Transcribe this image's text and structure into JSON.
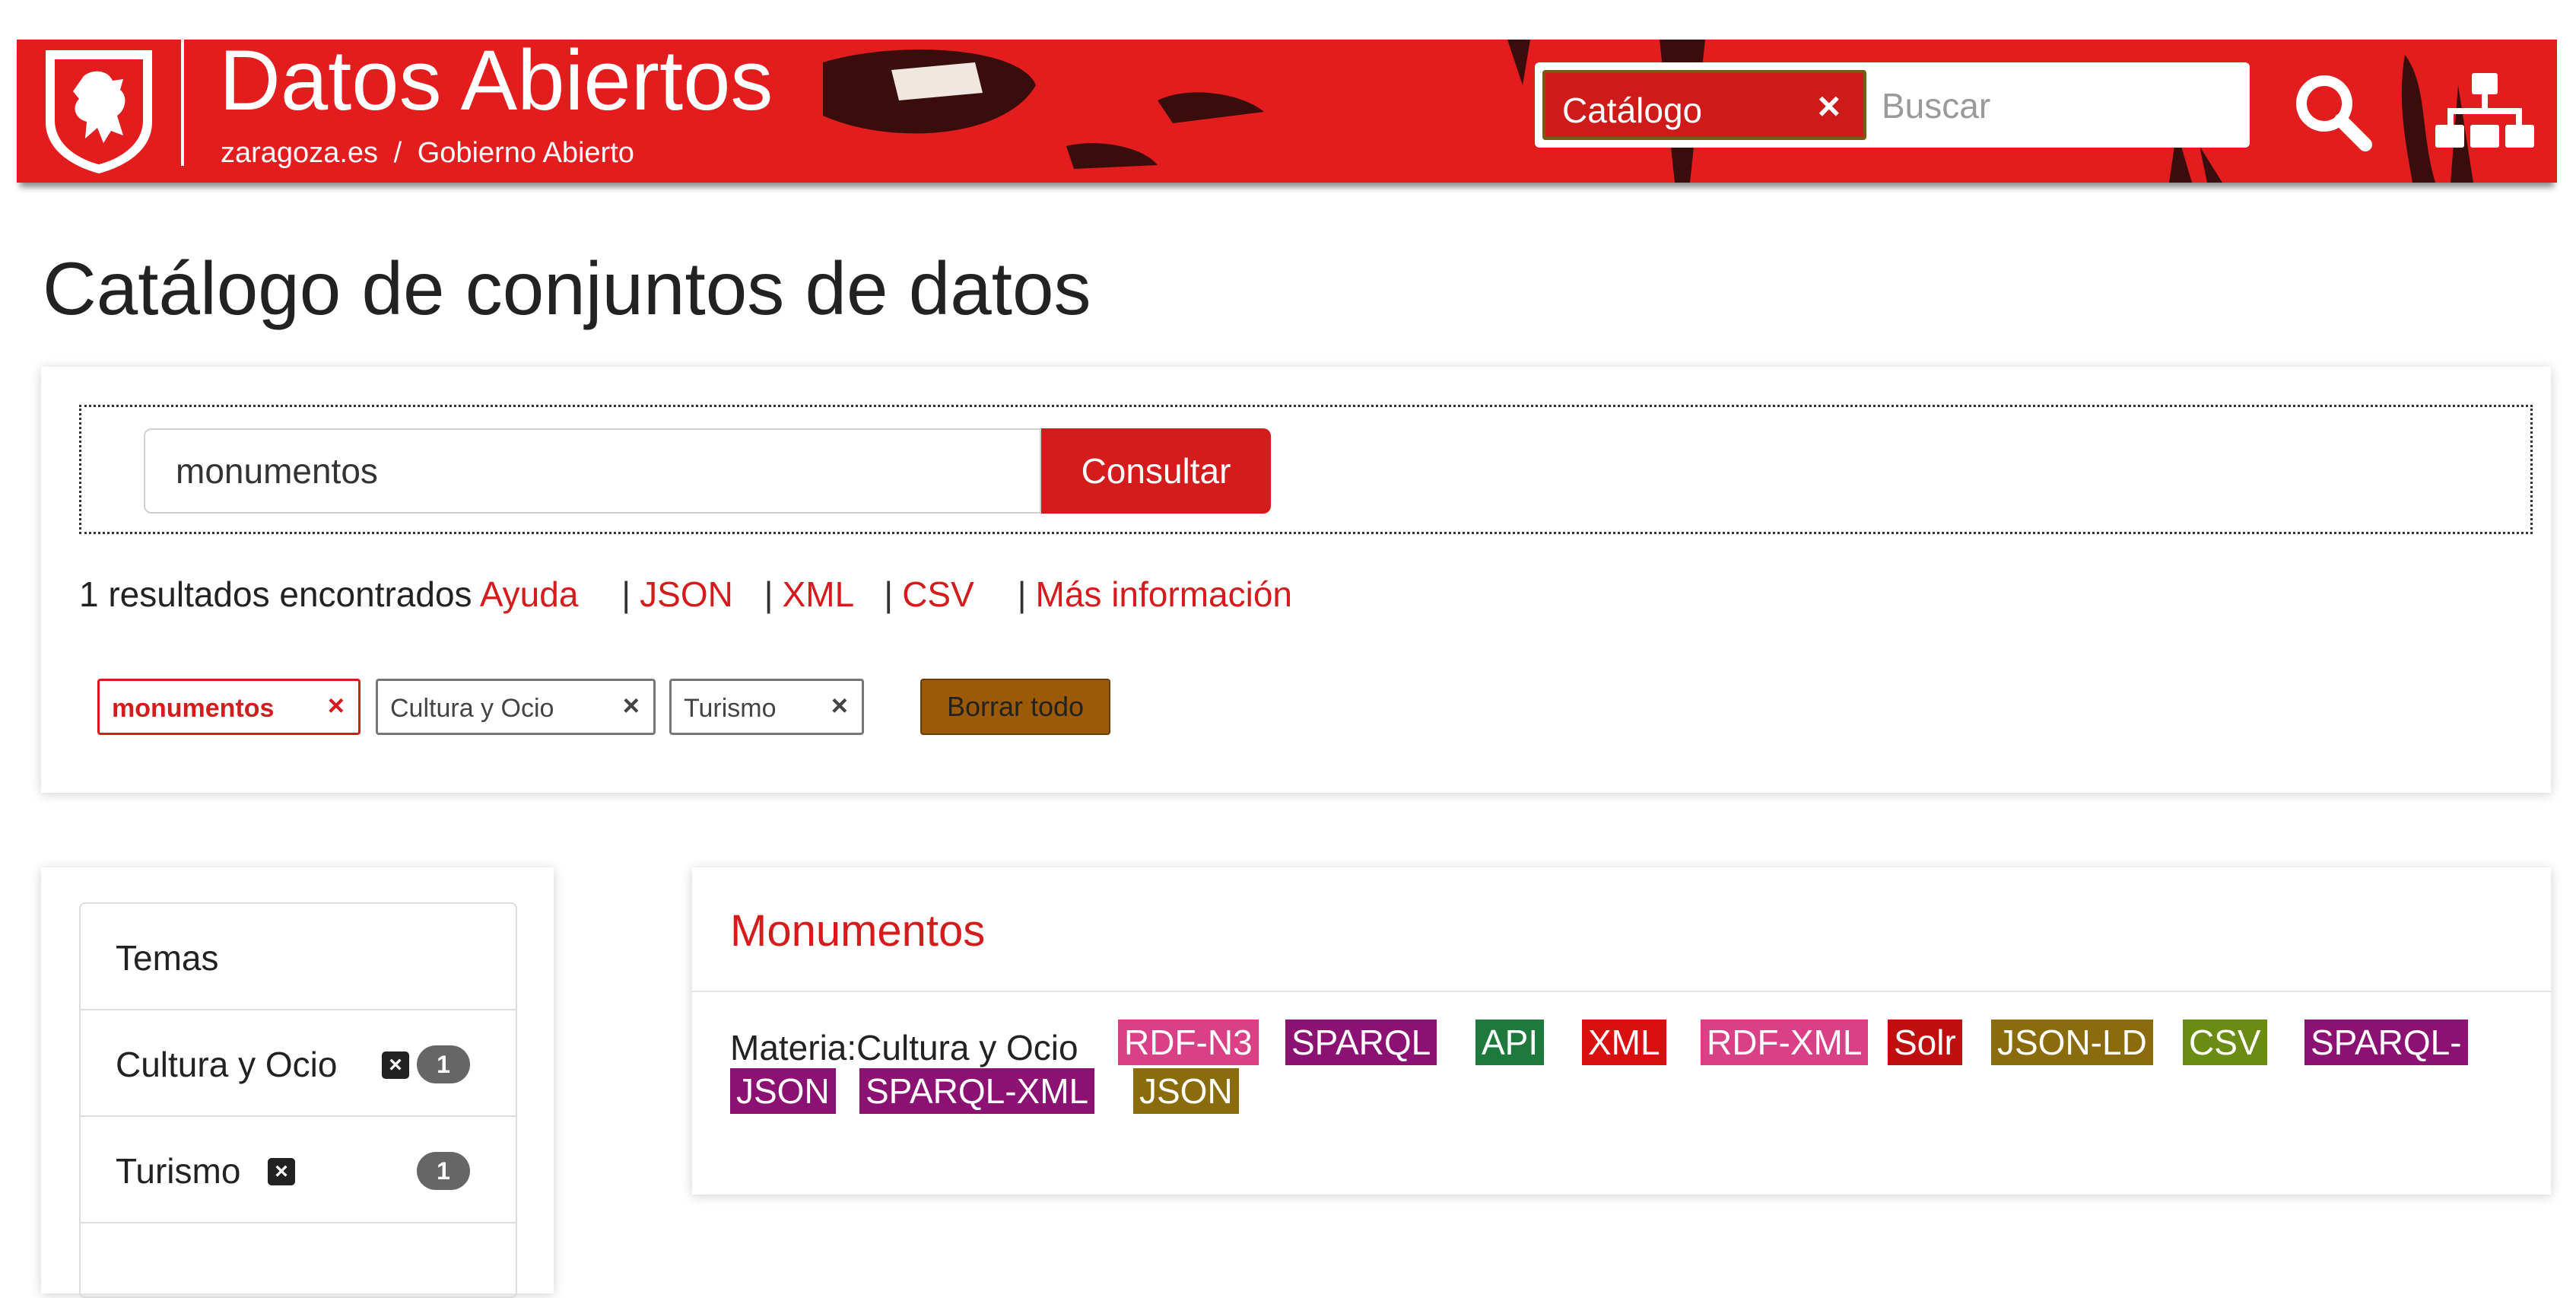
{
  "header": {
    "site_title": "Datos Abiertos",
    "breadcrumb": [
      "zaragoza.es",
      "Gobierno Abierto"
    ],
    "breadcrumb_separator": "/",
    "search": {
      "scope_chip": "Catálogo",
      "placeholder": "Buscar"
    },
    "icons": [
      "zaragoza-lion-shield-icon",
      "search-icon",
      "sitemap-icon"
    ],
    "color": "#e31d1d"
  },
  "page": {
    "title": "Catálogo de conjuntos de datos"
  },
  "search_panel": {
    "query": "monumentos",
    "submit_label": "Consultar",
    "results_text": "1 resultados encontrados",
    "links": [
      "Ayuda",
      "JSON",
      "XML",
      "CSV",
      "Más información"
    ],
    "active_filters": [
      {
        "label": "monumentos",
        "style": "query"
      },
      {
        "label": "Cultura y Ocio",
        "style": "facet"
      },
      {
        "label": "Turismo",
        "style": "facet"
      }
    ],
    "clear_all_label": "Borrar todo",
    "remove_symbol": "×"
  },
  "sidebar": {
    "facet_title": "Temas",
    "items": [
      {
        "label": "Cultura y Ocio",
        "count": "1",
        "remove_symbol": "×"
      },
      {
        "label": "Turismo",
        "count": "1",
        "remove_symbol": "×"
      }
    ]
  },
  "results": [
    {
      "title": "Monumentos",
      "meta": "Materia:Cultura y Ocio",
      "formats": [
        {
          "label": "RDF-N3",
          "color": "#d94085"
        },
        {
          "label": "SPARQL",
          "color": "#8b1273"
        },
        {
          "label": "API",
          "color": "#1e7a3c"
        },
        {
          "label": "XML",
          "color": "#d90f0f"
        },
        {
          "label": "RDF-XML",
          "color": "#d94085"
        },
        {
          "label": "Solr",
          "color": "#c00d0d"
        },
        {
          "label": "JSON-LD",
          "color": "#8a6c0c"
        },
        {
          "label": "CSV",
          "color": "#6a8c12"
        },
        {
          "label": "SPARQL-",
          "color": "#8b1273"
        },
        {
          "label": "JSON",
          "color": "#8b1273"
        },
        {
          "label": "SPARQL-XML",
          "color": "#8b1273"
        },
        {
          "label": "JSON",
          "color": "#8a6c0c"
        }
      ]
    }
  ],
  "colors": {
    "accent": "#d41c1c",
    "clear_all": "#9c5a06"
  }
}
